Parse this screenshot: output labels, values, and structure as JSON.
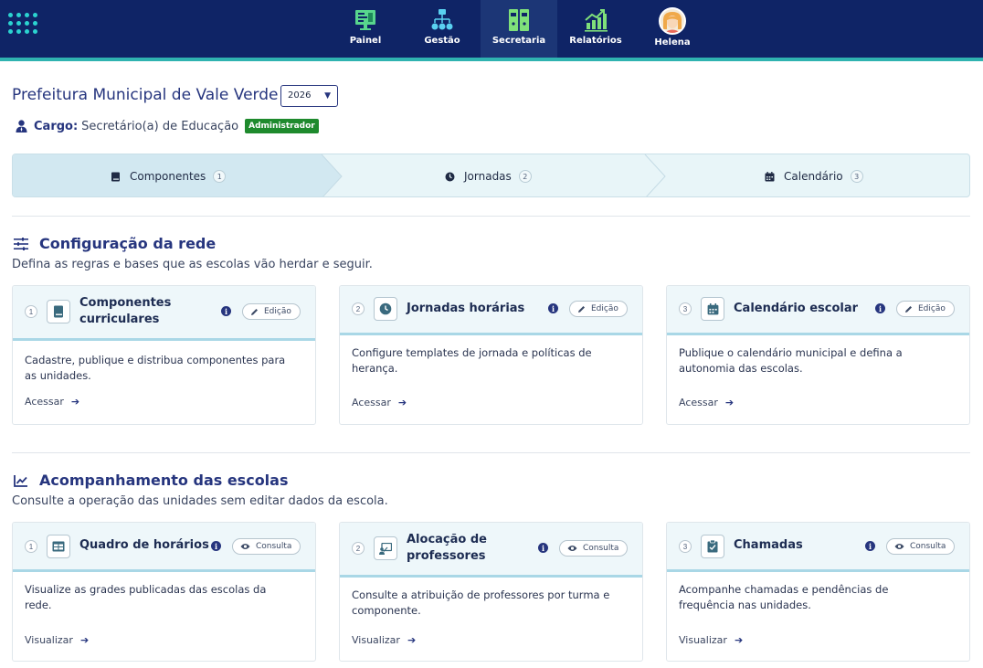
{
  "nav": {
    "items": [
      {
        "label": "Painel",
        "icon": "monitor-dashboard-icon"
      },
      {
        "label": "Gestão",
        "icon": "hierarchy-icon"
      },
      {
        "label": "Secretaria",
        "icon": "binders-icon",
        "active": true
      },
      {
        "label": "Relatórios",
        "icon": "chart-growth-icon"
      },
      {
        "label": "Helena",
        "icon": "user-avatar"
      }
    ]
  },
  "header": {
    "title": "Prefeitura Municipal de Vale Verde",
    "year": "2026",
    "cargo_label": "Cargo:",
    "cargo_value": "Secretário(a) de Educação",
    "role_badge": "Administrador"
  },
  "stepper": [
    {
      "label": "Componentes",
      "num": "1",
      "icon": "book-icon"
    },
    {
      "label": "Jornadas",
      "num": "2",
      "icon": "clock-icon"
    },
    {
      "label": "Calendário",
      "num": "3",
      "icon": "calendar-icon"
    }
  ],
  "section_config": {
    "title": "Configuração da rede",
    "subtitle": "Defina as regras e bases que as escolas vão herdar e seguir.",
    "cards": [
      {
        "num": "1",
        "title_line1": "Componentes",
        "title_line2": "curriculares",
        "pill": "Edição",
        "desc_line1": "Cadastre, publique e distribua componentes para",
        "desc_line2": "as unidades.",
        "link": "Acessar"
      },
      {
        "num": "2",
        "title_line1": "Jornadas horárias",
        "title_line2": "",
        "pill": "Edição",
        "desc_line1": "Configure templates de jornada e políticas de",
        "desc_line2": "herança.",
        "link": "Acessar"
      },
      {
        "num": "3",
        "title_line1": "Calendário escolar",
        "title_line2": "",
        "pill": "Edição",
        "desc_line1": "Publique o calendário municipal e defina a",
        "desc_line2": "autonomia das escolas.",
        "link": "Acessar"
      }
    ]
  },
  "section_tracking": {
    "title": "Acompanhamento das escolas",
    "subtitle": "Consulte a operação das unidades sem editar dados da escola.",
    "cards": [
      {
        "num": "1",
        "title_line1": "Quadro de horários",
        "title_line2": "",
        "pill": "Consulta",
        "desc_line1": "Visualize as grades publicadas das escolas da",
        "desc_line2": "rede.",
        "link": "Visualizar"
      },
      {
        "num": "2",
        "title_line1": "Alocação de",
        "title_line2": "professores",
        "pill": "Consulta",
        "desc_line1": "Consulte a atribuição de professores por turma e",
        "desc_line2": "componente.",
        "link": "Visualizar"
      },
      {
        "num": "3",
        "title_line1": "Chamadas",
        "title_line2": "",
        "pill": "Consulta",
        "desc_line1": "Acompanhe chamadas e pendências de",
        "desc_line2": "frequência nas unidades.",
        "link": "Visualizar"
      }
    ]
  },
  "colors": {
    "topbar": "#0f2466",
    "accent": "#2fb3b0",
    "primary": "#26357e",
    "badge_green": "#1e8a2d"
  }
}
